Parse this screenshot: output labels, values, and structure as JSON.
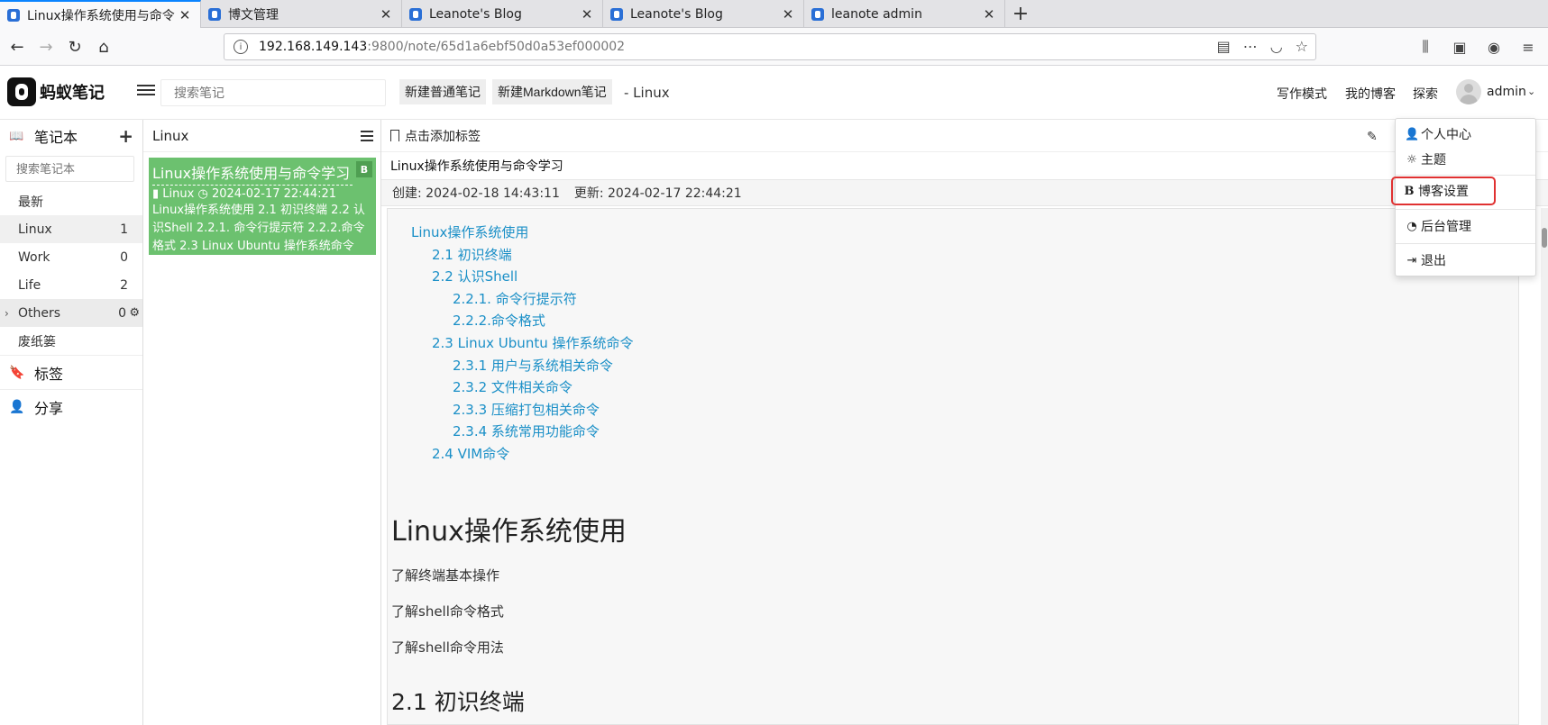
{
  "browser": {
    "tabs": [
      {
        "title": "Linux操作系统使用与命令",
        "active": true
      },
      {
        "title": "博文管理",
        "active": false
      },
      {
        "title": "Leanote's Blog",
        "active": false
      },
      {
        "title": "Leanote's Blog",
        "active": false
      },
      {
        "title": "leanote admin",
        "active": false
      }
    ],
    "url_host": "192.168.149.143",
    "url_path": ":9800/note/65d1a6ebf50d0a53ef000002"
  },
  "header": {
    "app_name": "蚂蚁笔记",
    "search_placeholder": "搜索笔记",
    "new_note_label": "新建普通笔记",
    "new_markdown_label": "新建Markdown笔记",
    "crumb": "- Linux",
    "write_mode": "写作模式",
    "my_blog": "我的博客",
    "explore": "探索",
    "username": "admin"
  },
  "sidebar": {
    "notebook_title": "笔记本",
    "notebook_search_placeholder": "搜索笔记本",
    "recent": "最新",
    "notebooks": [
      {
        "name": "Linux",
        "count": "1"
      },
      {
        "name": "Work",
        "count": "0"
      },
      {
        "name": "Life",
        "count": "2"
      },
      {
        "name": "Others",
        "count": "0"
      }
    ],
    "trash": "废纸篓",
    "tags": "标签",
    "share": "分享"
  },
  "notelist": {
    "title": "Linux",
    "note": {
      "title": "Linux操作系统使用与命令学习",
      "badge": "B",
      "notebook": "Linux",
      "time": "2024-02-17 22:44:21",
      "desc": "Linux操作系统使用 2.1 初识终端 2.2 认识Shell 2.2.1. 命令行提示符 2.2.2.命令格式 2.3 Linux Ubuntu 操作系统命令"
    }
  },
  "editor": {
    "add_tag": "点击添加标签",
    "title": "Linux操作系统使用与命令学习",
    "created": "创建: 2024-02-18 14:43:11",
    "updated": "更新: 2024-02-17 22:44:21",
    "toc": [
      "Linux操作系统使用",
      "2.1 初识终端",
      "2.2 认识Shell",
      "2.2.1. 命令行提示符",
      "2.2.2.命令格式",
      "2.3 Linux Ubuntu 操作系统命令",
      "2.3.1 用户与系统相关命令",
      "2.3.2 文件相关命令",
      "2.3.3 压缩打包相关命令",
      "2.3.4 系统常用功能命令",
      "2.4 VIM命令"
    ],
    "heading1": "Linux操作系统使用",
    "paragraphs": [
      "了解终端基本操作",
      "了解shell命令格式",
      "了解shell命令用法"
    ],
    "heading2": "2.1 初识终端"
  },
  "dropdown": {
    "items": [
      "个人中心",
      "主题",
      "博客设置",
      "后台管理",
      "退出"
    ]
  },
  "colors": {
    "accent_green": "#6cc16f",
    "link_blue": "#1a8fc7",
    "highlight_red": "#e03131"
  }
}
